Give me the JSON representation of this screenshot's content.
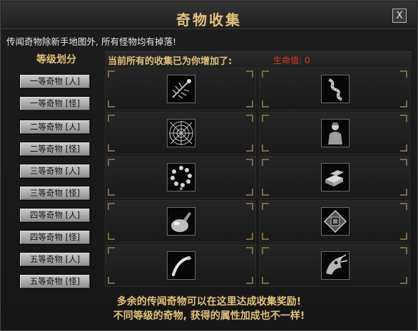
{
  "window": {
    "title": "奇物收集",
    "close_label": "X",
    "notice": "传闻奇物除新手地图外, 所有怪物均有掉落!"
  },
  "sidebar": {
    "header": "等级划分",
    "items": [
      {
        "label": "一等奇物 [人]"
      },
      {
        "label": "一等奇物 [怪]"
      },
      {
        "label": "二等奇物 [人]"
      },
      {
        "label": "二等奇物 [怪]"
      },
      {
        "label": "三等奇物 [人]"
      },
      {
        "label": "三等奇物 [怪]"
      },
      {
        "label": "四等奇物 [人]"
      },
      {
        "label": "四等奇物 [怪]"
      },
      {
        "label": "五等奇物 [人]"
      },
      {
        "label": "五等奇物 [怪]"
      }
    ]
  },
  "collection": {
    "header": "当前所有的收集已为你增加了:",
    "hp_label": "生命值: 0",
    "items": [
      {
        "icon": "fish-bone-icon"
      },
      {
        "icon": "rope-coil-icon"
      },
      {
        "icon": "cobweb-icon"
      },
      {
        "icon": "warrior-statue-icon"
      },
      {
        "icon": "prayer-beads-icon"
      },
      {
        "icon": "stone-bricks-icon"
      },
      {
        "icon": "potion-gourd-icon"
      },
      {
        "icon": "scroll-tablet-icon"
      },
      {
        "icon": "curved-horn-icon"
      },
      {
        "icon": "dragon-skull-icon"
      }
    ]
  },
  "footer": {
    "line1": "多余的传闻奇物可以在这里达成收集奖励!",
    "line2": "不同等级的奇物, 获得的属性加成也不一样!"
  }
}
